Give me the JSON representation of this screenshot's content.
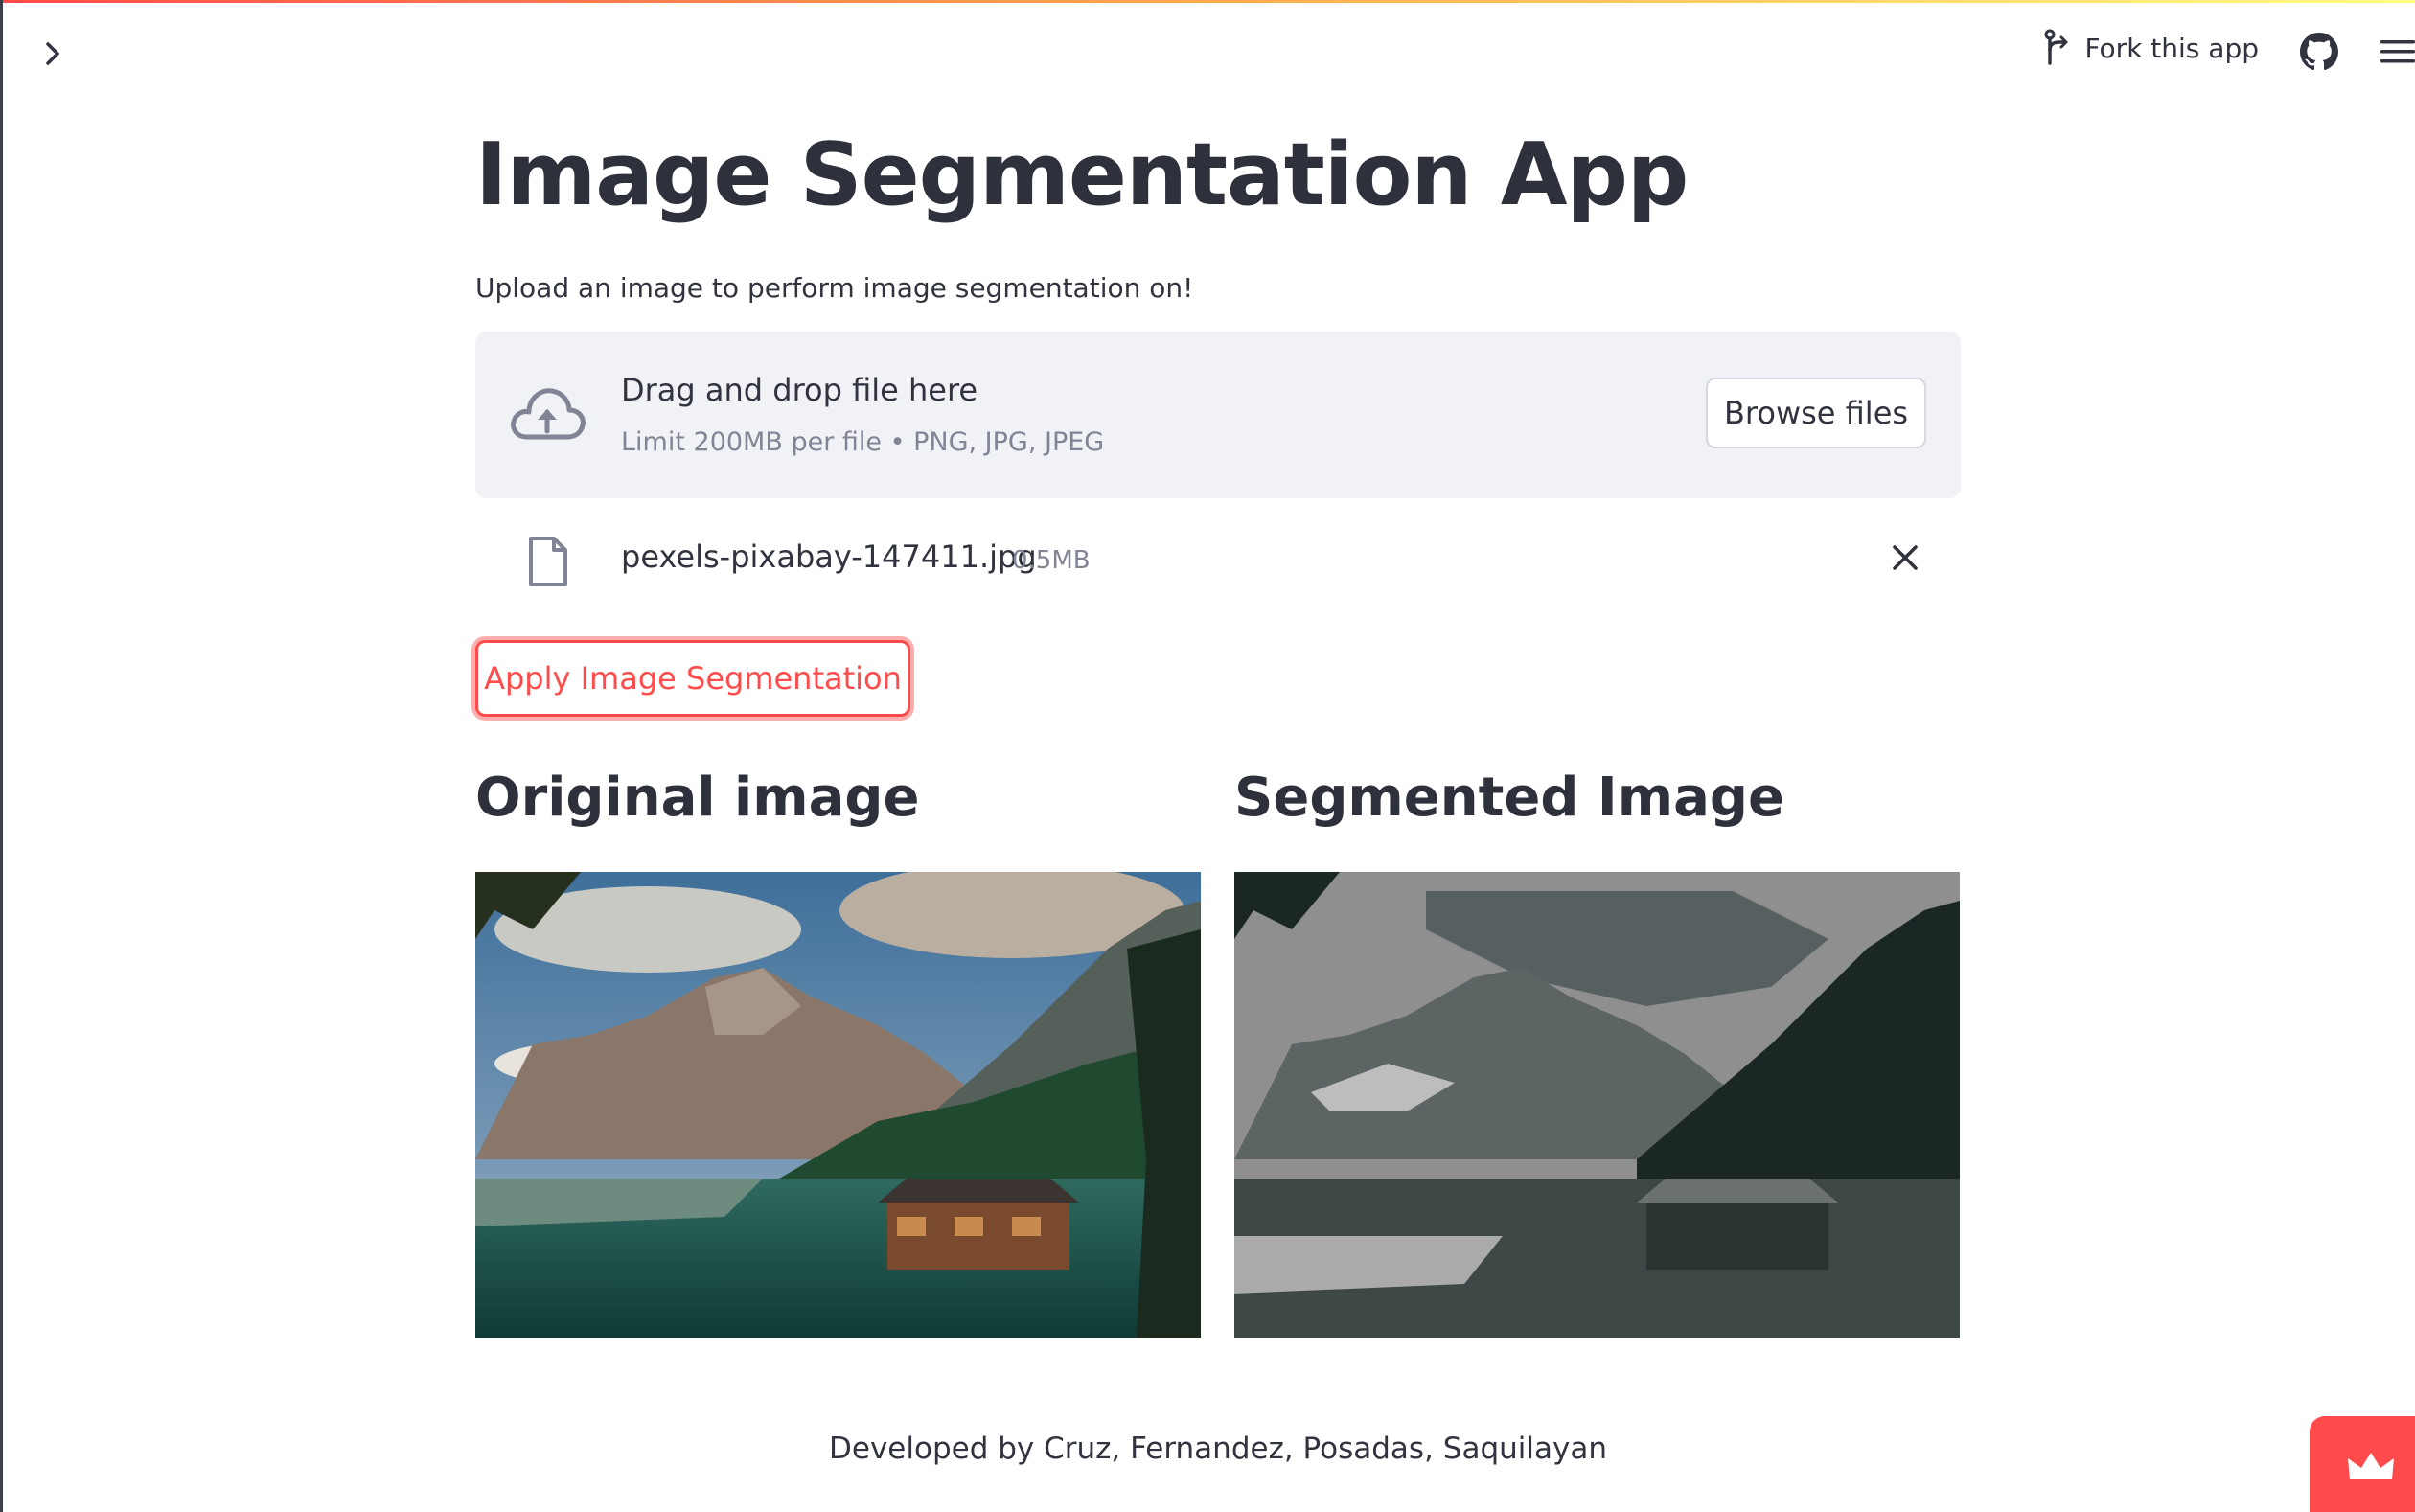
{
  "header": {
    "fork_label": "Fork this app",
    "icons": [
      "chevron-right-icon",
      "fork-icon",
      "github-icon",
      "hamburger-menu-icon"
    ]
  },
  "main": {
    "title": "Image Segmentation App",
    "subtitle": "Upload an image to perform image segmentation on!"
  },
  "uploader": {
    "drag_text": "Drag and drop file here",
    "limit_text": "Limit 200MB per file • PNG, JPG, JPEG",
    "browse_label": "Browse files"
  },
  "uploaded_file": {
    "name": "pexels-pixabay-147411.jpg",
    "size": "0.5MB"
  },
  "apply_button": "Apply Image Segmentation",
  "columns": {
    "original_heading": "Original image",
    "segmented_heading": "Segmented Image"
  },
  "footer": "Developed by Cruz, Fernandez, Posadas, Saquilayan",
  "colors": {
    "accent": "#ff4b4b",
    "text": "#31333f",
    "dropzone_bg": "#f0f2f6",
    "muted": "#808495"
  }
}
